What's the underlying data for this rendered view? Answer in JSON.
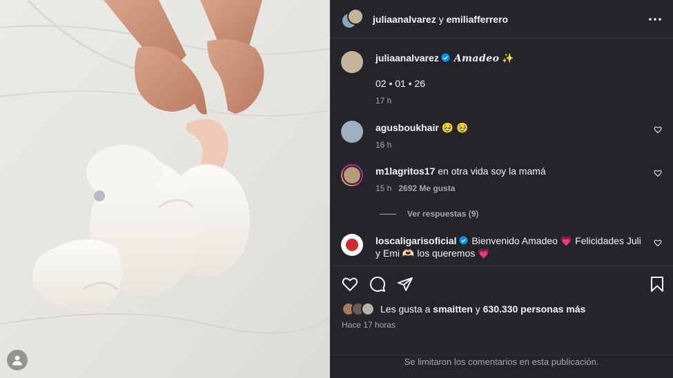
{
  "header": {
    "user1": "juliaanalvarez",
    "connector": "y",
    "user2": "emiliafferrero",
    "more_icon": "more-horizontal-icon"
  },
  "caption": {
    "username": "juliaanalvarez",
    "title": "Amadeo",
    "emoji": "✨",
    "date": "02 • 01 • 26",
    "time": "17 h"
  },
  "comments": [
    {
      "username": "agusboukhair",
      "text": "🥹 🥹",
      "time": "16 h",
      "likes": "",
      "verified": false
    },
    {
      "username": "m1lagritos17",
      "text": "en otra vida soy la mamá",
      "time": "15 h",
      "likes": "2692 Me gusta",
      "verified": false
    },
    {
      "username": "loscaligarisoficial",
      "text": "Bienvenido Amadeo 💗  Felicidades Juli y Emi 🫶🏻 los queremos 💗",
      "time": "",
      "likes": "",
      "verified": true
    }
  ],
  "view_replies": "Ver respuestas (9)",
  "actions": {
    "like_icon": "heart-icon",
    "comment_icon": "comment-icon",
    "share_icon": "send-icon",
    "save_icon": "bookmark-icon"
  },
  "likes_summary": {
    "prefix": "Les gusta a",
    "user": "smaitten",
    "middle": "y",
    "count": "630.330 personas más"
  },
  "posted": "Hace 17 horas",
  "comments_limited": "Se limitaron los comentarios en esta publicación.",
  "colors": {
    "panel": "#24252a",
    "verified": "#0095f6",
    "muted": "#a8a8a8",
    "text": "#f5f5f5"
  }
}
